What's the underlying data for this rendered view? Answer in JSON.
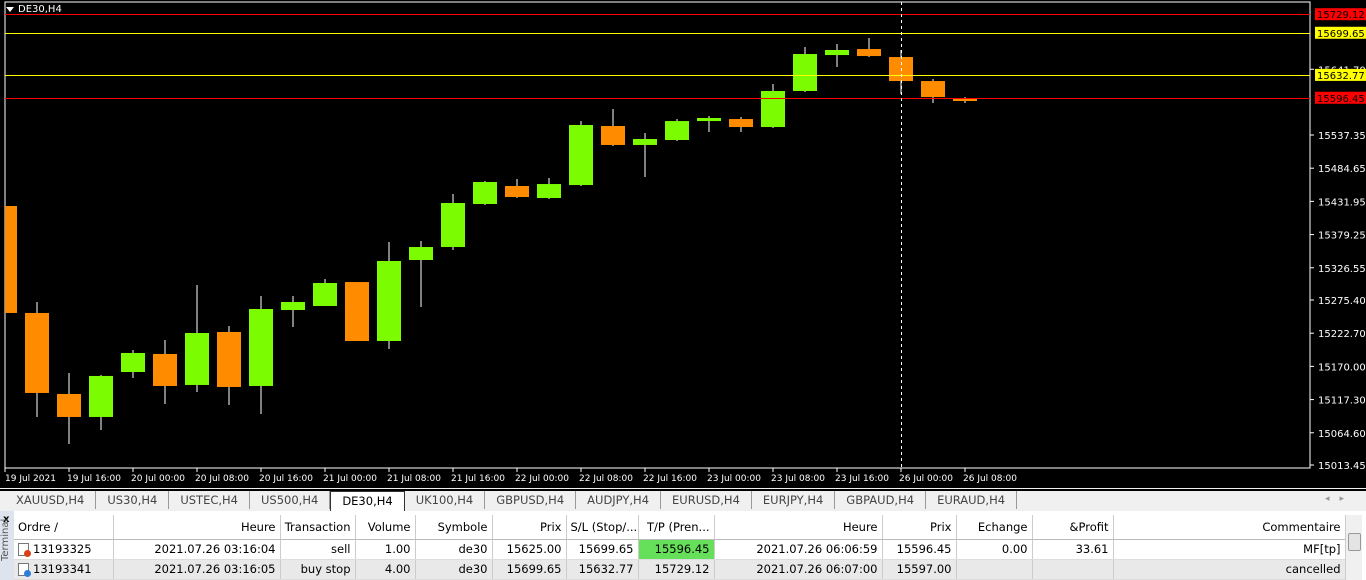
{
  "chart": {
    "title": "DE30,H4",
    "bull_color": "#7cfc00",
    "bear_color": "#ff8c00",
    "yaxis": [
      "15641.70",
      "15537.35",
      "15484.65",
      "15431.95",
      "15379.25",
      "15326.55",
      "15275.40",
      "15222.70",
      "15170.00",
      "15117.30",
      "15064.60",
      "15013.45"
    ],
    "xaxis": [
      "19 Jul 2021",
      "19 Jul 16:00",
      "20 Jul 00:00",
      "20 Jul 08:00",
      "20 Jul 16:00",
      "21 Jul 00:00",
      "21 Jul 08:00",
      "21 Jul 16:00",
      "22 Jul 00:00",
      "22 Jul 08:00",
      "22 Jul 16:00",
      "23 Jul 00:00",
      "23 Jul 08:00",
      "23 Jul 16:00",
      "26 Jul 00:00",
      "26 Jul 08:00"
    ],
    "levels": [
      {
        "label": "15729.12",
        "price": 15729.12,
        "color": "#ff0000",
        "text_color": "#000"
      },
      {
        "label": "15699.65",
        "price": 15699.65,
        "color": "#ffff00",
        "text_color": "#000"
      },
      {
        "label": "15632.77",
        "price": 15632.77,
        "color": "#ffff00",
        "text_color": "#000"
      },
      {
        "label": "15596.45",
        "price": 15596.45,
        "color": "#ff0000",
        "text_color": "#000"
      }
    ],
    "crosshair_candle": 29,
    "ohlc": [
      [
        15424.6,
        15450.0,
        15254.8,
        15254.8
      ],
      [
        15254.8,
        15272.2,
        15089.7,
        15127.8
      ],
      [
        15126.2,
        15159.5,
        15046.8,
        15089.7
      ],
      [
        15089.7,
        15156.3,
        15069.0,
        15154.8
      ],
      [
        15161.1,
        15196.0,
        15151.6,
        15191.3
      ],
      [
        15189.7,
        15211.9,
        15110.3,
        15138.9
      ],
      [
        15140.5,
        15299.2,
        15129.3,
        15223.0
      ],
      [
        15224.6,
        15234.1,
        15108.7,
        15137.3
      ],
      [
        15138.9,
        15281.8,
        15094.4,
        15261.1
      ],
      [
        15259.5,
        15281.8,
        15232.5,
        15272.2
      ],
      [
        15265.9,
        15308.7,
        15265.9,
        15302.4
      ],
      [
        15303.9,
        15303.9,
        15210.3,
        15210.3
      ],
      [
        15210.3,
        15367.5,
        15197.6,
        15337.3
      ],
      [
        15338.9,
        15369.1,
        15264.3,
        15359.5
      ],
      [
        15359.5,
        15443.7,
        15354.8,
        15429.4
      ],
      [
        15427.8,
        15464.3,
        15426.2,
        15462.7
      ],
      [
        15456.4,
        15467.5,
        15437.3,
        15438.9
      ],
      [
        15437.3,
        15469.1,
        15435.7,
        15459.5
      ],
      [
        15457.9,
        15559.5,
        15456.4,
        15553.2
      ],
      [
        15551.6,
        15578.6,
        15519.9,
        15521.5
      ],
      [
        15521.5,
        15540.5,
        15470.6,
        15531.0
      ],
      [
        15529.4,
        15562.7,
        15527.8,
        15559.5
      ],
      [
        15559.5,
        15567.5,
        15542.1,
        15564.3
      ],
      [
        15562.7,
        15565.9,
        15542.1,
        15550.0
      ],
      [
        15550.0,
        15618.3,
        15548.4,
        15607.2
      ],
      [
        15607.2,
        15677.0,
        15605.6,
        15665.9
      ],
      [
        15664.3,
        15681.8,
        15645.3,
        15672.3
      ],
      [
        15673.8,
        15691.3,
        15661.1,
        15662.7
      ],
      [
        15661.1,
        15672.3,
        15602.4,
        15623.0
      ],
      [
        15623.0,
        15626.2,
        15588.1,
        15597.6
      ],
      [
        15596.0,
        15597.6,
        15588.1,
        15591.3
      ]
    ]
  },
  "tabs": [
    "XAUUSD,H4",
    "US30,H4",
    "USTEC,H4",
    "US500,H4",
    "DE30,H4",
    "UK100,H4",
    "GBPUSD,H4",
    "AUDJPY,H4",
    "EURUSD,H4",
    "EURJPY,H4",
    "GBPAUD,H4",
    "EURAUD,H4"
  ],
  "active_tab": 4,
  "terminal": {
    "side_label": "Terminal",
    "close": "x",
    "columns": [
      "Ordre  /",
      "Heure",
      "Transaction",
      "Volume",
      "Symbole",
      "Prix",
      "S/L (Stop/...",
      "T/P (Pren...",
      "Heure",
      "Prix",
      "Echange",
      "&Profit",
      "Commentaire"
    ],
    "rows": [
      [
        "13193325",
        "2021.07.26 03:16:04",
        "sell",
        "1.00",
        "de30",
        "15625.00",
        "15699.65",
        "15596.45",
        "2021.07.26 06:06:59",
        "15596.45",
        "0.00",
        "33.61",
        "MF[tp]"
      ],
      [
        "13193341",
        "2021.07.26 03:16:05",
        "buy stop",
        "4.00",
        "de30",
        "15699.65",
        "15632.77",
        "15729.12",
        "2021.07.26 06:07:00",
        "15597.00",
        "",
        "",
        "cancelled"
      ]
    ]
  }
}
